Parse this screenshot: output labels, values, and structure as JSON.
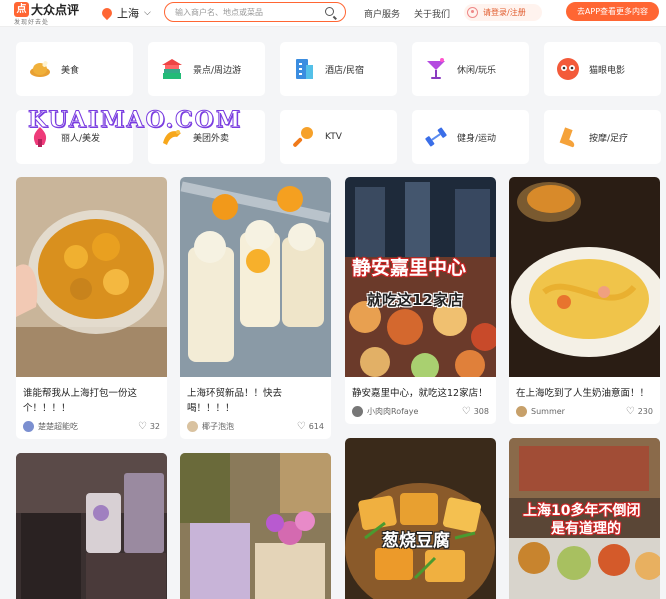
{
  "header": {
    "logo_name": "大众点评",
    "logo_slogan": "发现好去处",
    "city": "上海",
    "search_placeholder": "输入商户名、地点或菜品",
    "merchant_service": "商户服务",
    "about_us": "关于我们",
    "login": "请登录/注册",
    "app_button": "去APP查看更多内容"
  },
  "categories": [
    {
      "label": "美食",
      "icon": "roast-chicken-icon"
    },
    {
      "label": "景点/周边游",
      "icon": "temple-icon"
    },
    {
      "label": "酒店/民宿",
      "icon": "hotel-building-icon"
    },
    {
      "label": "休闲/玩乐",
      "icon": "cocktail-icon"
    },
    {
      "label": "猫眼电影",
      "icon": "maoyan-owl-icon"
    },
    {
      "label": "丽人/美发",
      "icon": "lipstick-icon"
    },
    {
      "label": "美团外卖",
      "icon": "kangaroo-icon"
    },
    {
      "label": "KTV",
      "icon": "microphone-icon"
    },
    {
      "label": "健身/运动",
      "icon": "dumbbell-icon"
    },
    {
      "label": "按摩/足疗",
      "icon": "foot-icon"
    }
  ],
  "watermark": "KUAIMAO.COM",
  "feed": [
    {
      "title": "谁能帮我从上海打包一份这个！！！！",
      "user": "楚楚超能吃",
      "likes": "32",
      "image": "mango-dessert-bowl",
      "overlay": ""
    },
    {
      "title": "上海环贸新品！！快去喝！！！！",
      "user": "椰子泡泡",
      "likes": "614",
      "image": "orange-cream-drinks",
      "overlay": ""
    },
    {
      "title": "静安嘉里中心，就吃这12家店！",
      "user": "小肉肉Rofaye",
      "likes": "308",
      "image": "jingan-kerry-collage",
      "overlay": "静安嘉里中心",
      "overlay2": "就吃这12家店"
    },
    {
      "title": "在上海吃到了人生奶油意面！！",
      "user": "Summer",
      "likes": "230",
      "image": "cream-pasta",
      "overlay": ""
    },
    {
      "title": "",
      "user": "",
      "likes": "",
      "image": "jewelry-store",
      "overlay": ""
    },
    {
      "title": "",
      "user": "",
      "likes": "",
      "image": "flower-gift-shop",
      "overlay": ""
    },
    {
      "title": "",
      "user": "",
      "likes": "",
      "image": "scallion-tofu",
      "overlay": "葱烧豆腐"
    },
    {
      "title": "",
      "user": "",
      "likes": "",
      "image": "old-restaurant-dishes",
      "overlay": "上海10多年不倒闭",
      "overlay2": "是有道理的"
    }
  ]
}
